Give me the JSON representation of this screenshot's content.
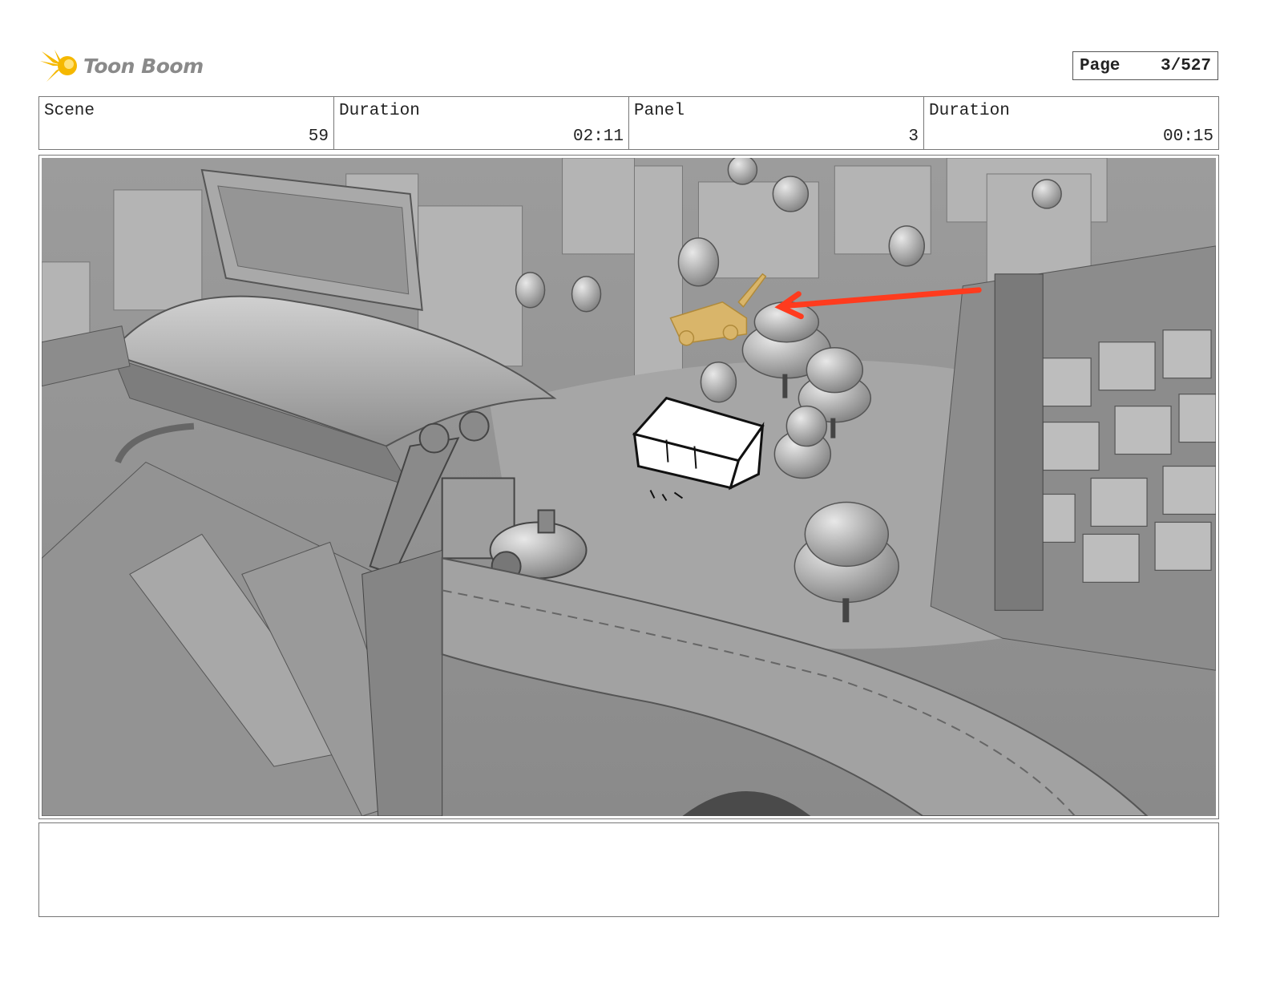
{
  "header": {
    "brand": "Toon Boom",
    "page_label": "Page",
    "page_value": "3/527"
  },
  "info": {
    "scene_label": "Scene",
    "scene_value": "59",
    "scene_duration_label": "Duration",
    "scene_duration_value": "02:11",
    "panel_label": "Panel",
    "panel_value": "3",
    "panel_duration_label": "Duration",
    "panel_duration_value": "00:15"
  },
  "colors": {
    "logo_accent": "#f5b800",
    "annotation_arrow": "#ff3b1e",
    "vehicle": "#d9b56a"
  },
  "notes": ""
}
